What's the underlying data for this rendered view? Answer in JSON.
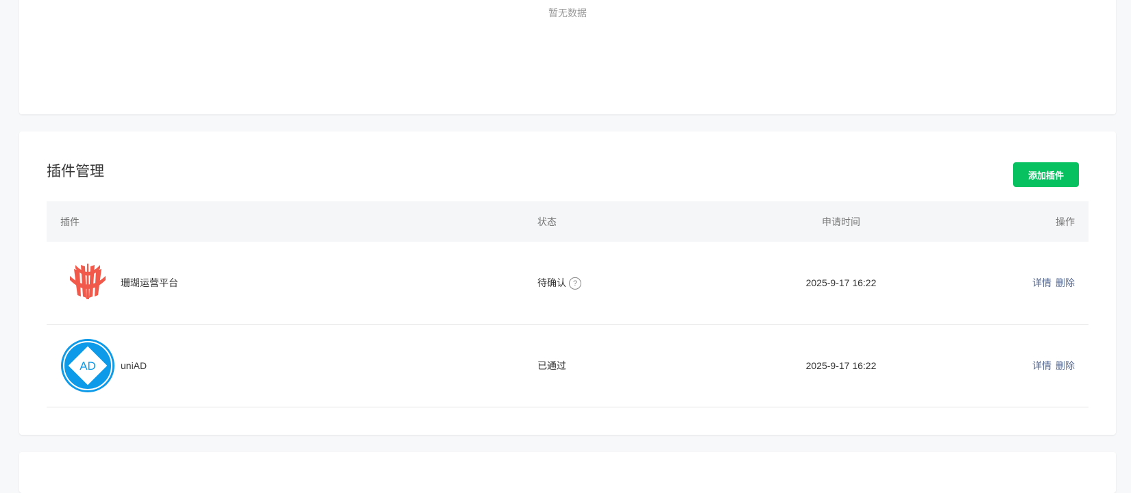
{
  "top_card": {
    "empty_text": "暂无数据"
  },
  "plugins_section": {
    "title": "插件管理",
    "add_button": "添加插件",
    "table": {
      "headers": {
        "plugin": "插件",
        "status": "状态",
        "time": "申请时间",
        "ops": "操作"
      },
      "rows": [
        {
          "name": "珊瑚运营平台",
          "status": "待确认",
          "help": "?",
          "time": "2025-9-17 16:22",
          "detail": "详情",
          "delete": "删除",
          "logo": "coral-icon"
        },
        {
          "name": "uniAD",
          "status": "已通过",
          "time": "2025-9-17 16:22",
          "detail": "详情",
          "delete": "删除",
          "logo": "uniad-icon",
          "logo_text": "AD"
        }
      ]
    }
  },
  "colors": {
    "primary": "#07c160",
    "link": "#576b95",
    "coral": "#f15a4a",
    "uniad_blue": "#0d9ae8"
  }
}
